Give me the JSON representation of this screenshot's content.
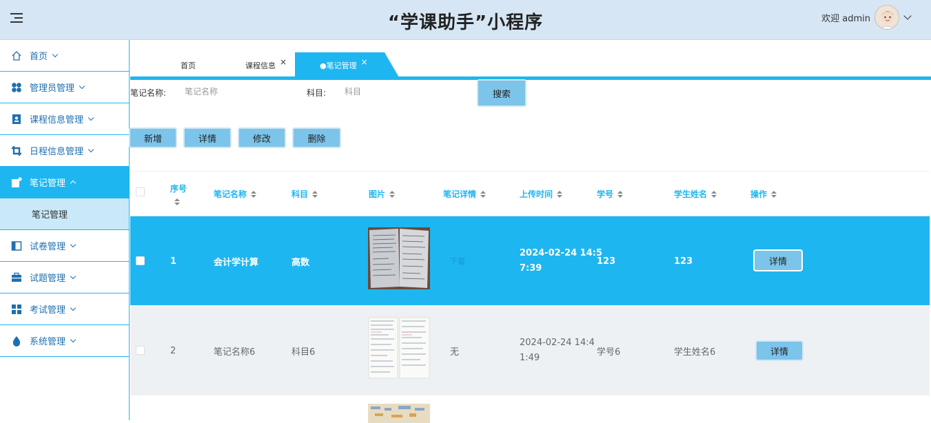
{
  "header": {
    "title": "“学课助手”小程序",
    "welcome": "欢迎 admin"
  },
  "sidebar": {
    "items": [
      {
        "label": "首页",
        "icon": "home-icon"
      },
      {
        "label": "管理员管理",
        "icon": "clover-icon"
      },
      {
        "label": "课程信息管理",
        "icon": "contact-book-icon"
      },
      {
        "label": "日程信息管理",
        "icon": "crop-icon"
      },
      {
        "label": "笔记管理",
        "icon": "note-edit-icon",
        "active": true
      },
      {
        "label": "试卷管理",
        "icon": "paper-icon"
      },
      {
        "label": "试题管理",
        "icon": "briefcase-icon"
      },
      {
        "label": "考试管理",
        "icon": "grid-icon"
      },
      {
        "label": "系统管理",
        "icon": "drop-icon"
      }
    ],
    "sub_item": "笔记管理"
  },
  "tabs": [
    {
      "label": "首页"
    },
    {
      "label": "课程信息",
      "close": "×"
    },
    {
      "label": "●笔记管理",
      "close": "×",
      "active": true
    }
  ],
  "search": {
    "name_label": "笔记名称:",
    "name_placeholder": "笔记名称",
    "subject_label": "科目:",
    "subject_placeholder": "科目",
    "button": "搜索"
  },
  "actions": {
    "add": "新增",
    "detail": "详情",
    "edit": "修改",
    "delete": "删除"
  },
  "table": {
    "headers": [
      "序号",
      "笔记名称",
      "科目",
      "图片",
      "笔记详情",
      "上传时间",
      "学号",
      "学生姓名",
      "操作"
    ],
    "rows": [
      {
        "index": "1",
        "name": "会计学计算",
        "subject": "高数",
        "detail": "下载",
        "time_line1": "2024-02-24 14:5",
        "time_line2": "7:39",
        "student_no": "123",
        "student_name": "123",
        "action": "详情"
      },
      {
        "index": "2",
        "name": "笔记名称6",
        "subject": "科目6",
        "detail": "无",
        "time_line1": "2024-02-24 14:4",
        "time_line2": "1:49",
        "student_no": "学号6",
        "student_name": "学生姓名6",
        "action": "详情"
      }
    ]
  },
  "colors": {
    "accent": "#1eb6f0",
    "button": "#7cc4ea",
    "header_bg": "#d6e6f4"
  }
}
